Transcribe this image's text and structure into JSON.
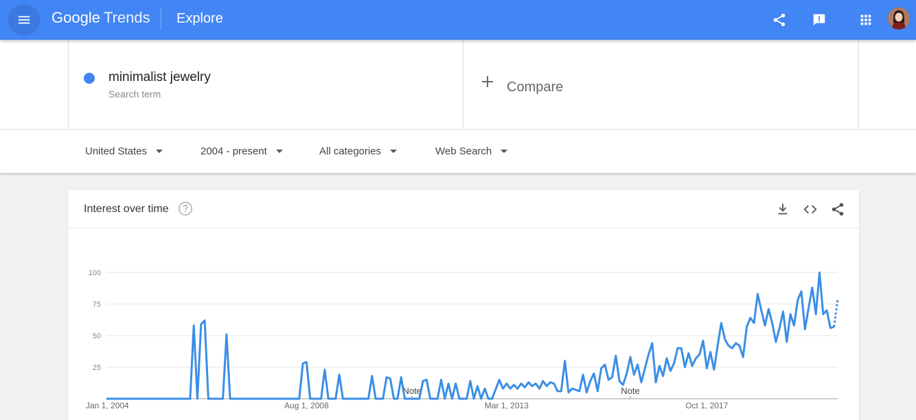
{
  "header": {
    "logo_google": "Google",
    "logo_trends": "Trends",
    "page_title": "Explore",
    "menu_icon": "hamburger-menu-icon",
    "share_icon": "share-icon",
    "feedback_icon": "feedback-icon",
    "apps_icon": "apps-grid-icon",
    "brand_color": "#4285f4"
  },
  "search_term": {
    "term": "minimalist jewelry",
    "type": "Search term",
    "color": "#4285f4"
  },
  "compare": {
    "label": "Compare"
  },
  "filters": {
    "region": "United States",
    "time_range": "2004 - present",
    "category": "All categories",
    "search_type": "Web Search"
  },
  "interest_card": {
    "title": "Interest over time",
    "help_icon": "help-circle-icon",
    "download_icon": "download-icon",
    "embed_icon": "embed-code-icon",
    "share_icon": "share-icon"
  },
  "chart_data": {
    "type": "line",
    "title": "Interest over time",
    "y_ticks": [
      "100",
      "75",
      "50",
      "25"
    ],
    "ylim": [
      0,
      100
    ],
    "x_range": [
      "2004-01",
      "2019-09"
    ],
    "x_tick_labels": [
      {
        "label": "Jan 1, 2004",
        "date": "2004-01"
      },
      {
        "label": "Aug 1, 2008",
        "date": "2008-08"
      },
      {
        "label": "Mar 1, 2013",
        "date": "2013-03"
      },
      {
        "label": "Oct 1, 2017",
        "date": "2017-10"
      }
    ],
    "notes": [
      {
        "label": "Note",
        "date": "2011-01"
      },
      {
        "label": "Note",
        "date": "2016-01"
      }
    ],
    "series": [
      {
        "color": "#4285f4",
        "points": [
          [
            "2004-01",
            0
          ],
          [
            "2005-12",
            0
          ],
          [
            "2006-01",
            58
          ],
          [
            "2006-02",
            0
          ],
          [
            "2006-03",
            59
          ],
          [
            "2006-04",
            62
          ],
          [
            "2006-05",
            0
          ],
          [
            "2006-09",
            0
          ],
          [
            "2006-10",
            51
          ],
          [
            "2006-11",
            0
          ],
          [
            "2008-06",
            0
          ],
          [
            "2008-07",
            28
          ],
          [
            "2008-08",
            29
          ],
          [
            "2008-09",
            0
          ],
          [
            "2008-12",
            0
          ],
          [
            "2009-01",
            23
          ],
          [
            "2009-02",
            0
          ],
          [
            "2009-04",
            0
          ],
          [
            "2009-05",
            19
          ],
          [
            "2009-06",
            0
          ],
          [
            "2010-01",
            0
          ],
          [
            "2010-02",
            18
          ],
          [
            "2010-03",
            0
          ],
          [
            "2010-05",
            0
          ],
          [
            "2010-06",
            17
          ],
          [
            "2010-07",
            16
          ],
          [
            "2010-08",
            0
          ],
          [
            "2010-09",
            0
          ],
          [
            "2010-10",
            17
          ],
          [
            "2010-11",
            0
          ],
          [
            "2011-03",
            0
          ],
          [
            "2011-04",
            14
          ],
          [
            "2011-05",
            15
          ],
          [
            "2011-06",
            0
          ],
          [
            "2011-08",
            0
          ],
          [
            "2011-09",
            15
          ],
          [
            "2011-10",
            0
          ],
          [
            "2011-11",
            12
          ],
          [
            "2011-12",
            0
          ],
          [
            "2012-01",
            12
          ],
          [
            "2012-02",
            0
          ],
          [
            "2012-03",
            0
          ],
          [
            "2012-04",
            0
          ],
          [
            "2012-05",
            14
          ],
          [
            "2012-06",
            0
          ],
          [
            "2012-07",
            10
          ],
          [
            "2012-08",
            0
          ],
          [
            "2012-09",
            8
          ],
          [
            "2012-10",
            0
          ],
          [
            "2012-11",
            0
          ],
          [
            "2013-01",
            15
          ],
          [
            "2013-02",
            8
          ],
          [
            "2013-03",
            12
          ],
          [
            "2013-04",
            8
          ],
          [
            "2013-05",
            11
          ],
          [
            "2013-06",
            8
          ],
          [
            "2013-07",
            12
          ],
          [
            "2013-08",
            9
          ],
          [
            "2013-09",
            13
          ],
          [
            "2013-10",
            10
          ],
          [
            "2013-11",
            12
          ],
          [
            "2013-12",
            8
          ],
          [
            "2014-01",
            14
          ],
          [
            "2014-02",
            10
          ],
          [
            "2014-03",
            13
          ],
          [
            "2014-04",
            12
          ],
          [
            "2014-05",
            6
          ],
          [
            "2014-06",
            6
          ],
          [
            "2014-07",
            30
          ],
          [
            "2014-08",
            5
          ],
          [
            "2014-09",
            8
          ],
          [
            "2014-10",
            7
          ],
          [
            "2014-11",
            6
          ],
          [
            "2014-12",
            19
          ],
          [
            "2015-01",
            5
          ],
          [
            "2015-02",
            14
          ],
          [
            "2015-03",
            20
          ],
          [
            "2015-04",
            6
          ],
          [
            "2015-05",
            24
          ],
          [
            "2015-06",
            27
          ],
          [
            "2015-07",
            15
          ],
          [
            "2015-08",
            17
          ],
          [
            "2015-09",
            34
          ],
          [
            "2015-10",
            14
          ],
          [
            "2015-11",
            11
          ],
          [
            "2015-12",
            20
          ],
          [
            "2016-01",
            33
          ],
          [
            "2016-02",
            19
          ],
          [
            "2016-03",
            27
          ],
          [
            "2016-04",
            13
          ],
          [
            "2016-05",
            24
          ],
          [
            "2016-06",
            35
          ],
          [
            "2016-07",
            44
          ],
          [
            "2016-08",
            13
          ],
          [
            "2016-09",
            26
          ],
          [
            "2016-10",
            18
          ],
          [
            "2016-11",
            32
          ],
          [
            "2016-12",
            22
          ],
          [
            "2017-01",
            28
          ],
          [
            "2017-02",
            40
          ],
          [
            "2017-03",
            40
          ],
          [
            "2017-04",
            25
          ],
          [
            "2017-05",
            36
          ],
          [
            "2017-06",
            26
          ],
          [
            "2017-07",
            32
          ],
          [
            "2017-08",
            35
          ],
          [
            "2017-09",
            46
          ],
          [
            "2017-10",
            24
          ],
          [
            "2017-11",
            37
          ],
          [
            "2017-12",
            23
          ],
          [
            "2018-01",
            42
          ],
          [
            "2018-02",
            60
          ],
          [
            "2018-03",
            47
          ],
          [
            "2018-04",
            42
          ],
          [
            "2018-05",
            40
          ],
          [
            "2018-06",
            44
          ],
          [
            "2018-07",
            42
          ],
          [
            "2018-08",
            33
          ],
          [
            "2018-09",
            57
          ],
          [
            "2018-10",
            64
          ],
          [
            "2018-11",
            60
          ],
          [
            "2018-12",
            83
          ],
          [
            "2019-01",
            70
          ],
          [
            "2019-02",
            58
          ],
          [
            "2019-03",
            71
          ],
          [
            "2019-04",
            60
          ],
          [
            "2019-05",
            45
          ],
          [
            "2019-06",
            56
          ],
          [
            "2019-07",
            69
          ],
          [
            "2019-08",
            45
          ],
          [
            "2019-09",
            67
          ],
          [
            "2019-10",
            58
          ],
          [
            "2019-11",
            78
          ],
          [
            "2019-12",
            85
          ],
          [
            "2020-01",
            55
          ],
          [
            "2020-02",
            72
          ],
          [
            "2020-03",
            88
          ],
          [
            "2020-04",
            67
          ],
          [
            "2020-05",
            100
          ],
          [
            "2020-06",
            67
          ],
          [
            "2020-07",
            70
          ],
          [
            "2020-08",
            56
          ],
          [
            "2020-09",
            57
          ]
        ],
        "partial_points": [
          [
            "2020-09",
            57
          ],
          [
            "2020-10",
            79
          ]
        ]
      }
    ]
  }
}
